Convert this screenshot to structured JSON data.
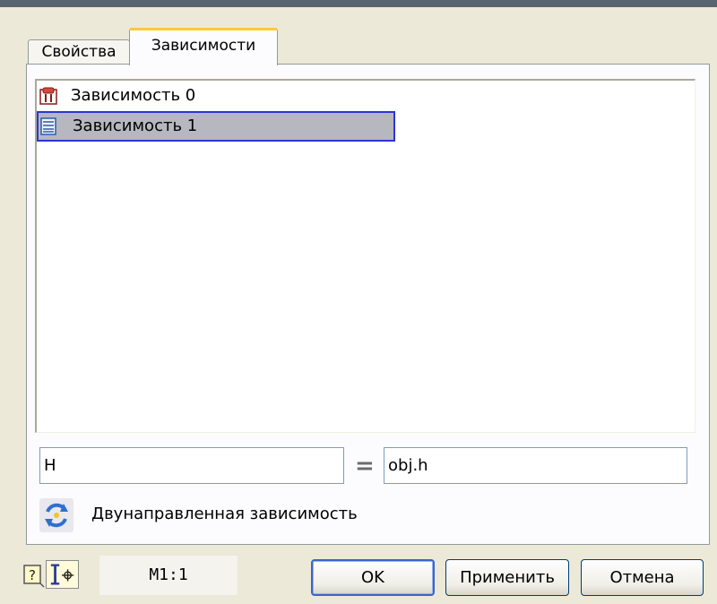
{
  "tabs": {
    "properties": "Свойства",
    "dependencies": "Зависимости"
  },
  "list": {
    "items": [
      {
        "label": "Зависимость 0",
        "icon": "dependency-icon",
        "selected": false
      },
      {
        "label": "Зависимость 1",
        "icon": "dependency-table-icon",
        "selected": true
      }
    ]
  },
  "fields": {
    "left_value": "H",
    "equals": "=",
    "right_value": "obj.h"
  },
  "bidirectional": {
    "label": "Двунаправленная зависимость",
    "icon": "bidirectional-refresh-icon"
  },
  "footer": {
    "scale": "M1:1",
    "ok_label": "OK",
    "apply_label": "Применить",
    "cancel_label": "Отмена"
  },
  "colors": {
    "dialog_bg": "#ece9d8",
    "selection_bg": "#b7b7bf",
    "selection_border": "#2a35d8",
    "tab_highlight": "#ffc83c"
  }
}
